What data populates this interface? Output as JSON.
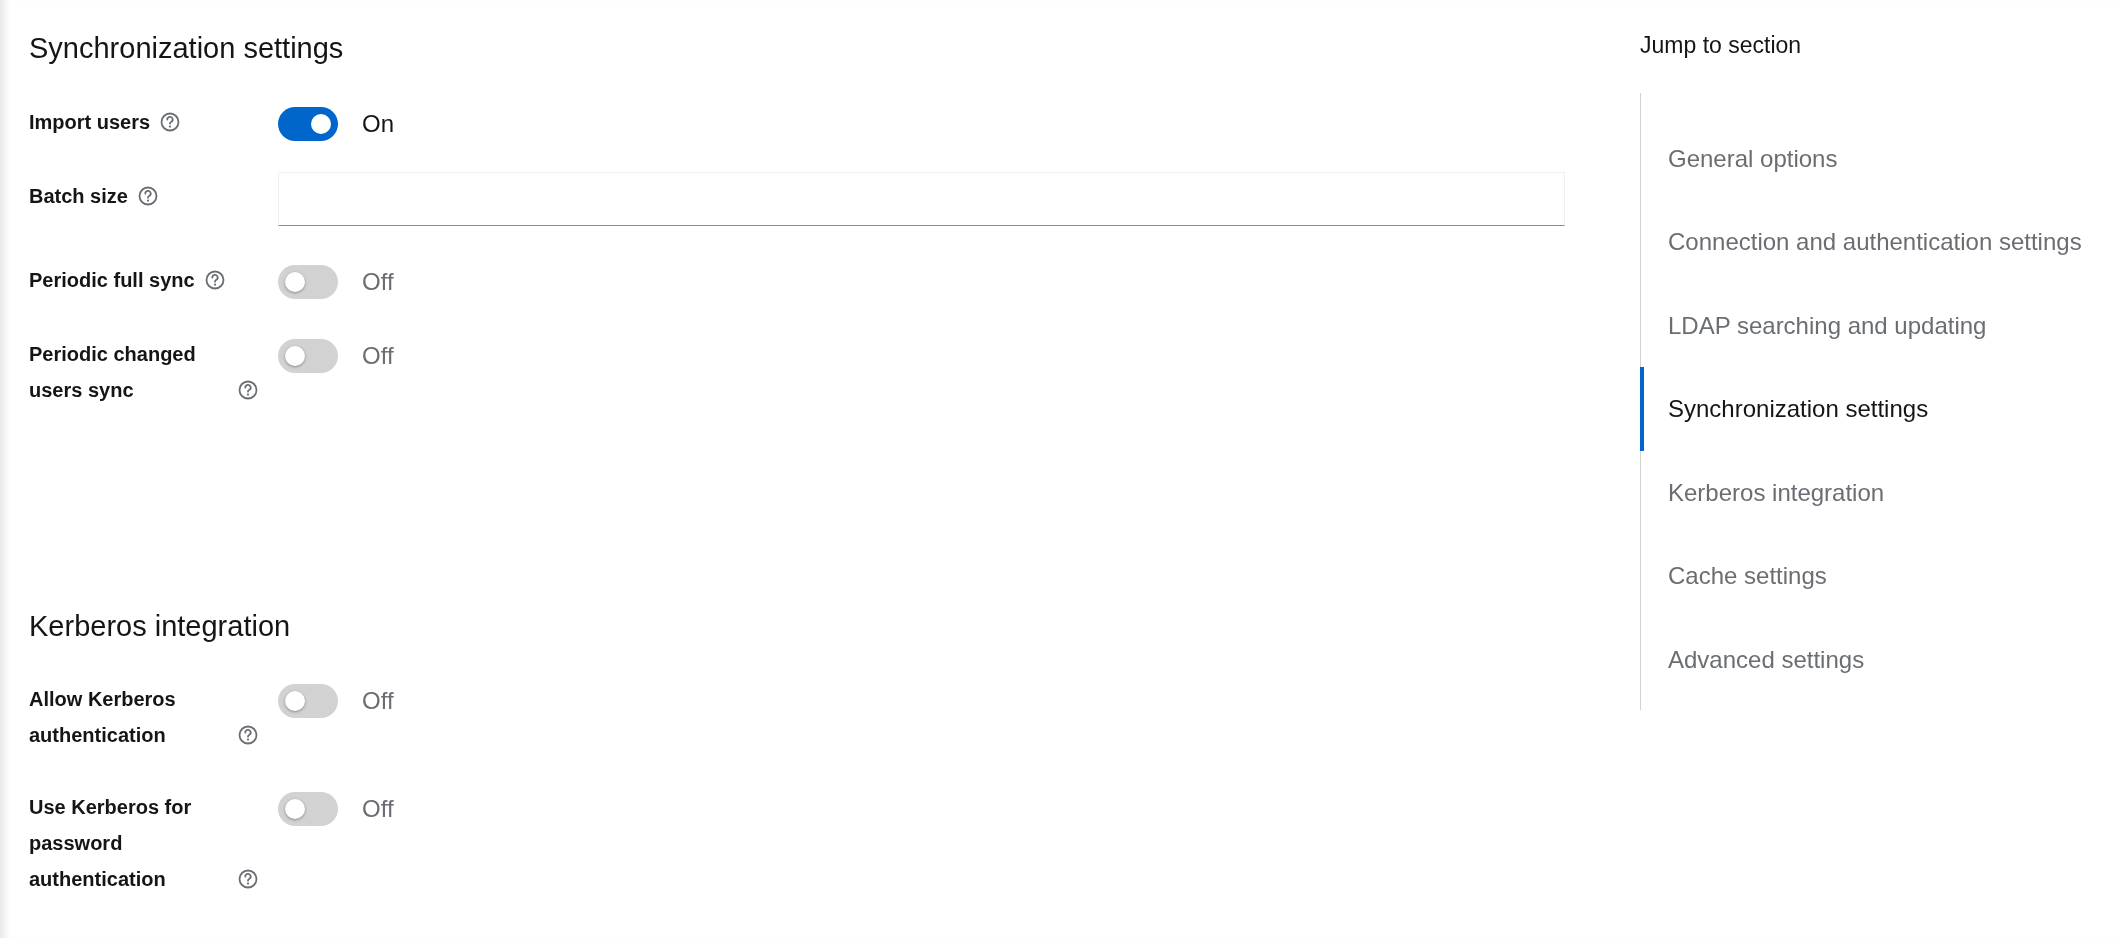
{
  "sections": [
    {
      "title": "Synchronization settings",
      "fields": [
        {
          "kind": "switch",
          "label": "Import users",
          "on": true,
          "state_text": "On"
        },
        {
          "kind": "text",
          "label": "Batch size"
        },
        {
          "kind": "switch",
          "label": "Periodic full sync",
          "on": false,
          "state_text": "Off"
        },
        {
          "kind": "switch",
          "label": "Periodic changed users sync",
          "on": false,
          "state_text": "Off"
        }
      ]
    },
    {
      "title": "Kerberos integration",
      "fields": [
        {
          "kind": "switch",
          "label": "Allow Kerberos authentication",
          "on": false,
          "state_text": "Off"
        },
        {
          "kind": "switch",
          "label": "Use Kerberos for password authentication",
          "on": false,
          "state_text": "Off"
        }
      ]
    }
  ],
  "jump_nav": {
    "title": "Jump to section",
    "items": [
      {
        "label": "General options",
        "selected": false
      },
      {
        "label": "Connection and authentication settings",
        "selected": false
      },
      {
        "label": "LDAP searching and updating",
        "selected": false
      },
      {
        "label": "Synchronization settings",
        "selected": true
      },
      {
        "label": "Kerberos integration",
        "selected": false
      },
      {
        "label": "Cache settings",
        "selected": false
      },
      {
        "label": "Advanced settings",
        "selected": false
      }
    ]
  }
}
